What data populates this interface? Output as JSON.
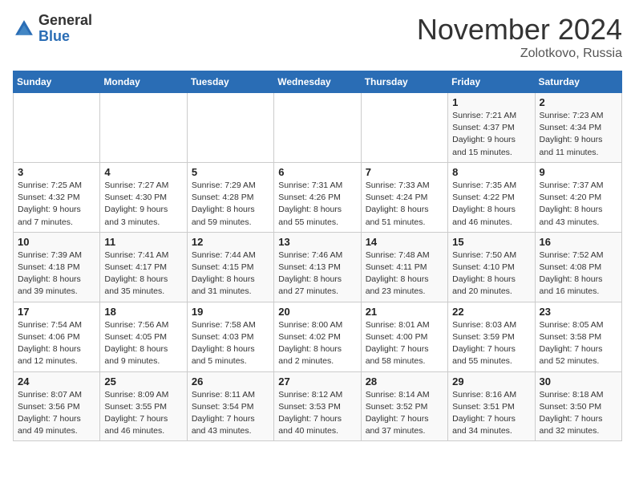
{
  "header": {
    "logo_general": "General",
    "logo_blue": "Blue",
    "month_title": "November 2024",
    "location": "Zolotkovo, Russia"
  },
  "days_of_week": [
    "Sunday",
    "Monday",
    "Tuesday",
    "Wednesday",
    "Thursday",
    "Friday",
    "Saturday"
  ],
  "weeks": [
    [
      null,
      null,
      null,
      null,
      null,
      {
        "day": "1",
        "sunrise": "Sunrise: 7:21 AM",
        "sunset": "Sunset: 4:37 PM",
        "daylight": "Daylight: 9 hours and 15 minutes."
      },
      {
        "day": "2",
        "sunrise": "Sunrise: 7:23 AM",
        "sunset": "Sunset: 4:34 PM",
        "daylight": "Daylight: 9 hours and 11 minutes."
      }
    ],
    [
      {
        "day": "3",
        "sunrise": "Sunrise: 7:25 AM",
        "sunset": "Sunset: 4:32 PM",
        "daylight": "Daylight: 9 hours and 7 minutes."
      },
      {
        "day": "4",
        "sunrise": "Sunrise: 7:27 AM",
        "sunset": "Sunset: 4:30 PM",
        "daylight": "Daylight: 9 hours and 3 minutes."
      },
      {
        "day": "5",
        "sunrise": "Sunrise: 7:29 AM",
        "sunset": "Sunset: 4:28 PM",
        "daylight": "Daylight: 8 hours and 59 minutes."
      },
      {
        "day": "6",
        "sunrise": "Sunrise: 7:31 AM",
        "sunset": "Sunset: 4:26 PM",
        "daylight": "Daylight: 8 hours and 55 minutes."
      },
      {
        "day": "7",
        "sunrise": "Sunrise: 7:33 AM",
        "sunset": "Sunset: 4:24 PM",
        "daylight": "Daylight: 8 hours and 51 minutes."
      },
      {
        "day": "8",
        "sunrise": "Sunrise: 7:35 AM",
        "sunset": "Sunset: 4:22 PM",
        "daylight": "Daylight: 8 hours and 46 minutes."
      },
      {
        "day": "9",
        "sunrise": "Sunrise: 7:37 AM",
        "sunset": "Sunset: 4:20 PM",
        "daylight": "Daylight: 8 hours and 43 minutes."
      }
    ],
    [
      {
        "day": "10",
        "sunrise": "Sunrise: 7:39 AM",
        "sunset": "Sunset: 4:18 PM",
        "daylight": "Daylight: 8 hours and 39 minutes."
      },
      {
        "day": "11",
        "sunrise": "Sunrise: 7:41 AM",
        "sunset": "Sunset: 4:17 PM",
        "daylight": "Daylight: 8 hours and 35 minutes."
      },
      {
        "day": "12",
        "sunrise": "Sunrise: 7:44 AM",
        "sunset": "Sunset: 4:15 PM",
        "daylight": "Daylight: 8 hours and 31 minutes."
      },
      {
        "day": "13",
        "sunrise": "Sunrise: 7:46 AM",
        "sunset": "Sunset: 4:13 PM",
        "daylight": "Daylight: 8 hours and 27 minutes."
      },
      {
        "day": "14",
        "sunrise": "Sunrise: 7:48 AM",
        "sunset": "Sunset: 4:11 PM",
        "daylight": "Daylight: 8 hours and 23 minutes."
      },
      {
        "day": "15",
        "sunrise": "Sunrise: 7:50 AM",
        "sunset": "Sunset: 4:10 PM",
        "daylight": "Daylight: 8 hours and 20 minutes."
      },
      {
        "day": "16",
        "sunrise": "Sunrise: 7:52 AM",
        "sunset": "Sunset: 4:08 PM",
        "daylight": "Daylight: 8 hours and 16 minutes."
      }
    ],
    [
      {
        "day": "17",
        "sunrise": "Sunrise: 7:54 AM",
        "sunset": "Sunset: 4:06 PM",
        "daylight": "Daylight: 8 hours and 12 minutes."
      },
      {
        "day": "18",
        "sunrise": "Sunrise: 7:56 AM",
        "sunset": "Sunset: 4:05 PM",
        "daylight": "Daylight: 8 hours and 9 minutes."
      },
      {
        "day": "19",
        "sunrise": "Sunrise: 7:58 AM",
        "sunset": "Sunset: 4:03 PM",
        "daylight": "Daylight: 8 hours and 5 minutes."
      },
      {
        "day": "20",
        "sunrise": "Sunrise: 8:00 AM",
        "sunset": "Sunset: 4:02 PM",
        "daylight": "Daylight: 8 hours and 2 minutes."
      },
      {
        "day": "21",
        "sunrise": "Sunrise: 8:01 AM",
        "sunset": "Sunset: 4:00 PM",
        "daylight": "Daylight: 7 hours and 58 minutes."
      },
      {
        "day": "22",
        "sunrise": "Sunrise: 8:03 AM",
        "sunset": "Sunset: 3:59 PM",
        "daylight": "Daylight: 7 hours and 55 minutes."
      },
      {
        "day": "23",
        "sunrise": "Sunrise: 8:05 AM",
        "sunset": "Sunset: 3:58 PM",
        "daylight": "Daylight: 7 hours and 52 minutes."
      }
    ],
    [
      {
        "day": "24",
        "sunrise": "Sunrise: 8:07 AM",
        "sunset": "Sunset: 3:56 PM",
        "daylight": "Daylight: 7 hours and 49 minutes."
      },
      {
        "day": "25",
        "sunrise": "Sunrise: 8:09 AM",
        "sunset": "Sunset: 3:55 PM",
        "daylight": "Daylight: 7 hours and 46 minutes."
      },
      {
        "day": "26",
        "sunrise": "Sunrise: 8:11 AM",
        "sunset": "Sunset: 3:54 PM",
        "daylight": "Daylight: 7 hours and 43 minutes."
      },
      {
        "day": "27",
        "sunrise": "Sunrise: 8:12 AM",
        "sunset": "Sunset: 3:53 PM",
        "daylight": "Daylight: 7 hours and 40 minutes."
      },
      {
        "day": "28",
        "sunrise": "Sunrise: 8:14 AM",
        "sunset": "Sunset: 3:52 PM",
        "daylight": "Daylight: 7 hours and 37 minutes."
      },
      {
        "day": "29",
        "sunrise": "Sunrise: 8:16 AM",
        "sunset": "Sunset: 3:51 PM",
        "daylight": "Daylight: 7 hours and 34 minutes."
      },
      {
        "day": "30",
        "sunrise": "Sunrise: 8:18 AM",
        "sunset": "Sunset: 3:50 PM",
        "daylight": "Daylight: 7 hours and 32 minutes."
      }
    ]
  ]
}
